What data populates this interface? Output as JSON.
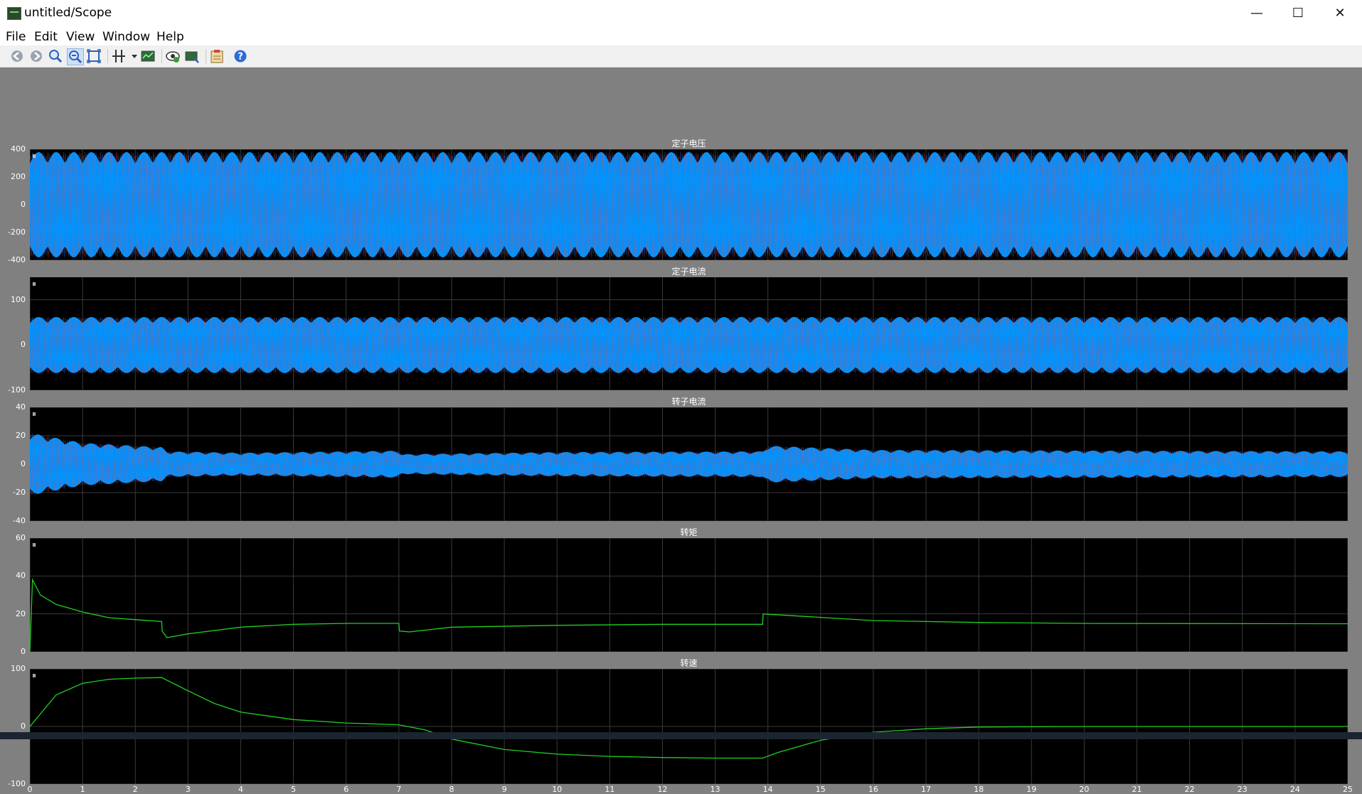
{
  "window": {
    "title": "untitled/Scope",
    "minimize": "—",
    "maximize": "☐",
    "close": "✕"
  },
  "menu": [
    "File",
    "Edit",
    "View",
    "Window",
    "Help"
  ],
  "toolbar_icons": [
    "back-icon",
    "forward-icon",
    "zoom-in-icon",
    "zoom-out-icon",
    "zoom-box-icon",
    "cursor-measure-icon",
    "dropdown-arrow-icon",
    "scope-params-icon",
    "highlight-icon",
    "export-icon",
    "properties-icon",
    "help-icon"
  ],
  "colors": {
    "phase_a": "#0a7cff",
    "phase_b": "#e0402a",
    "phase_c": "#7a5cc0",
    "fill": "#0096ff",
    "green": "#20d020",
    "grid": "#3a3a3a"
  },
  "chart_data": [
    {
      "type": "line",
      "title": "定子电压",
      "ylim": [
        -400,
        400
      ],
      "yticks": [
        "400",
        "200",
        "0",
        "-200",
        "-400"
      ],
      "envelope": {
        "kind": "constant",
        "amplitude": 380
      }
    },
    {
      "type": "line",
      "title": "定子电流",
      "ylim": [
        -100,
        150
      ],
      "yticks": [
        "100",
        "0",
        "-100"
      ],
      "envelope": {
        "kind": "constant",
        "amplitude": 62
      }
    },
    {
      "type": "line",
      "title": "转子电流",
      "ylim": [
        -40,
        40
      ],
      "yticks": [
        "40",
        "20",
        "0",
        "-20",
        "-40"
      ],
      "envelope": {
        "kind": "piecewise",
        "points": [
          [
            0,
            22
          ],
          [
            1,
            15
          ],
          [
            2.5,
            12
          ],
          [
            2.6,
            9
          ],
          [
            4,
            8
          ],
          [
            7,
            9.5
          ],
          [
            7.05,
            7
          ],
          [
            10,
            8.5
          ],
          [
            13.9,
            9
          ],
          [
            14,
            13
          ],
          [
            16,
            10
          ],
          [
            25,
            9
          ]
        ]
      }
    },
    {
      "type": "line",
      "title": "转矩",
      "ylim": [
        0,
        60
      ],
      "yticks": [
        "60",
        "40",
        "20",
        "0"
      ],
      "series": [
        {
          "name": "",
          "x": [
            0,
            0.05,
            0.2,
            0.5,
            1,
            1.5,
            2,
            2.5,
            2.51,
            2.6,
            3,
            4,
            5,
            6,
            7,
            7.01,
            7.2,
            8,
            10,
            12,
            13.9,
            13.91,
            14.5,
            16,
            18,
            20,
            25
          ],
          "y": [
            0,
            38,
            30,
            25,
            21,
            18,
            17,
            16,
            11,
            7.5,
            9.5,
            13,
            14.5,
            15,
            15,
            11,
            10.5,
            13,
            14,
            14.5,
            14.5,
            20,
            19,
            16.5,
            15.5,
            15,
            14.8
          ]
        }
      ]
    },
    {
      "type": "line",
      "title": "转速",
      "ylim": [
        -100,
        100
      ],
      "yticks": [
        "100",
        "0",
        "-100"
      ],
      "series": [
        {
          "name": "",
          "x": [
            0,
            0.5,
            1,
            1.5,
            2,
            2.5,
            3,
            3.5,
            4,
            5,
            6,
            7,
            7.5,
            8,
            9,
            10,
            11,
            12,
            13,
            13.9,
            14.2,
            15,
            16,
            17,
            18,
            20,
            25
          ],
          "y": [
            0,
            55,
            75,
            82,
            84,
            85,
            62,
            40,
            25,
            12,
            6,
            3,
            -6,
            -22,
            -40,
            -48,
            -52,
            -54,
            -55,
            -55,
            -45,
            -24,
            -10,
            -4,
            -1,
            0,
            0
          ]
        }
      ]
    }
  ],
  "xticks": [
    "0",
    "1",
    "2",
    "3",
    "4",
    "5",
    "6",
    "7",
    "8",
    "9",
    "10",
    "11",
    "12",
    "13",
    "14",
    "15",
    "16",
    "17",
    "18",
    "19",
    "20",
    "21",
    "22",
    "23",
    "24",
    "25"
  ],
  "xlim": [
    0,
    25
  ]
}
